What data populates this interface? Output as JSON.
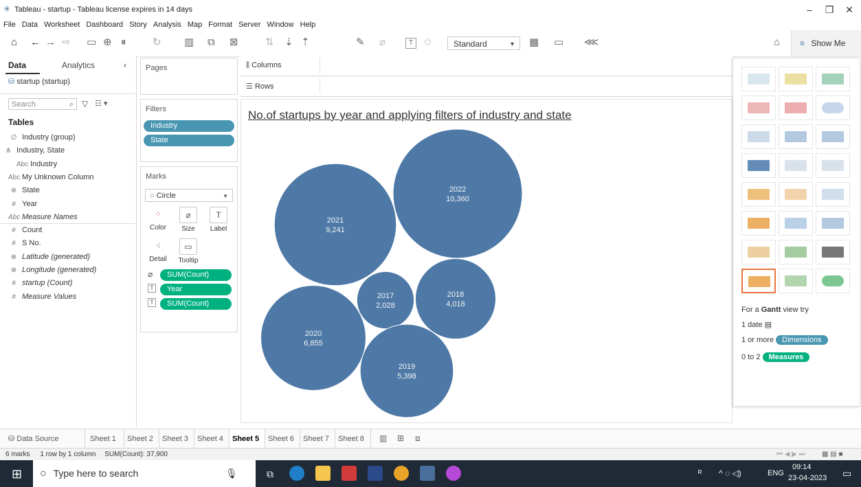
{
  "window": {
    "title": "Tableau - startup - Tableau license expires in 14 days"
  },
  "menu": [
    "File",
    "Data",
    "Worksheet",
    "Dashboard",
    "Story",
    "Analysis",
    "Map",
    "Format",
    "Server",
    "Window",
    "Help"
  ],
  "toolbar": {
    "standard_label": "Standard",
    "show_me_label": "Show Me"
  },
  "datapane": {
    "tab_data": "Data",
    "tab_analytics": "Analytics",
    "datasource": "startup (startup)",
    "search_placeholder": "Search",
    "tables_heading": "Tables",
    "fields": [
      {
        "icon": "∅",
        "label": "Industry (group)",
        "italic": false
      },
      {
        "icon": "⋔",
        "label": "Industry, State",
        "italic": false
      },
      {
        "icon": "Abc",
        "label": "Industry",
        "italic": false
      },
      {
        "icon": "Abc",
        "label": "My Unknown Column",
        "italic": false
      },
      {
        "icon": "⊕",
        "label": "State",
        "italic": false
      },
      {
        "icon": "#",
        "label": "Year",
        "italic": false
      },
      {
        "icon": "Abc",
        "label": "Measure Names",
        "italic": true
      },
      {
        "icon": "#",
        "label": "Count",
        "italic": false
      },
      {
        "icon": "#",
        "label": "S No.",
        "italic": false
      },
      {
        "icon": "⊕",
        "label": "Latitude (generated)",
        "italic": true
      },
      {
        "icon": "⊕",
        "label": "Longitude (generated)",
        "italic": true
      },
      {
        "icon": "#",
        "label": "startup (Count)",
        "italic": true
      },
      {
        "icon": "#",
        "label": "Measure Values",
        "italic": true
      }
    ]
  },
  "cards": {
    "pages_title": "Pages",
    "filters_title": "Filters",
    "filters": [
      "Industry",
      "State"
    ],
    "marks_title": "Marks",
    "mark_type": "Circle",
    "mark_buttons": [
      "Color",
      "Size",
      "Label",
      "Detail",
      "Tooltip"
    ],
    "mark_pills": [
      "SUM(Count)",
      "Year",
      "SUM(Count)"
    ]
  },
  "shelves": {
    "columns_label": "Columns",
    "rows_label": "Rows"
  },
  "viz": {
    "title": "No.of startups by year and applying filters of industry and state"
  },
  "chart_data": {
    "type": "packed-bubble",
    "title": "No.of startups by year and applying filters of industry and state",
    "categories": [
      "2017",
      "2018",
      "2019",
      "2020",
      "2021",
      "2022"
    ],
    "values": [
      2028,
      4018,
      5398,
      6855,
      9241,
      10360
    ],
    "value_labels": [
      "2,028",
      "4,018",
      "5,398",
      "6,855",
      "9,241",
      "10,360"
    ],
    "color": "#4e79a7",
    "label_color": "#ffffff"
  },
  "showme": {
    "hint_prefix": "For a",
    "hint_bold": "Gantt",
    "hint_suffix": "view try",
    "req1": "1 date",
    "req2_prefix": "1 or more",
    "req2_pill": "Dimensions",
    "req3_prefix": "0 to 2",
    "req3_pill": "Measures"
  },
  "sheettabs": {
    "datasource_label": "Data Source",
    "sheets": [
      "Sheet 1",
      "Sheet 2",
      "Sheet 3",
      "Sheet 4",
      "Sheet 5",
      "Sheet 6",
      "Sheet 7",
      "Sheet 8"
    ],
    "active": "Sheet 5"
  },
  "status": {
    "marks": "6 marks",
    "layout": "1 row by 1 column",
    "sum": "SUM(Count): 37,900"
  },
  "taskbar": {
    "search_placeholder": "Type here to search",
    "lang": "ENG",
    "time": "09:14",
    "date": "23-04-2023"
  }
}
